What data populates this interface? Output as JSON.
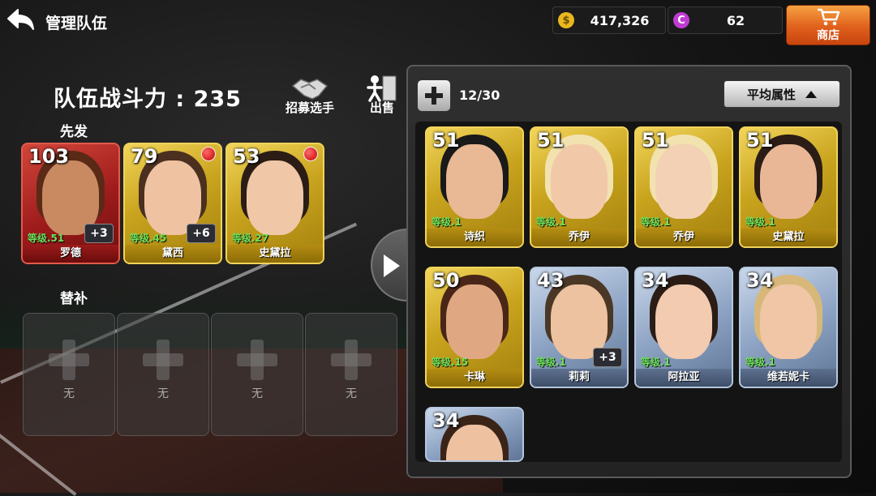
{
  "header": {
    "title": "管理队伍",
    "gold": "417,326",
    "gems": "62",
    "shop_label": "商店"
  },
  "team": {
    "power_label": "队伍战斗力 : 235",
    "recruit_label": "招募选手",
    "sell_label": "出售",
    "starters_label": "先发",
    "subs_label": "替补",
    "starters": [
      {
        "rating": "103",
        "level": "等级.51",
        "name": "罗德",
        "plus": "+3",
        "tier": "red",
        "alert": false
      },
      {
        "rating": "79",
        "level": "等级.45",
        "name": "黛西",
        "plus": "+6",
        "tier": "gold",
        "alert": true
      },
      {
        "rating": "53",
        "level": "等级.27",
        "name": "史黛拉",
        "plus": "",
        "tier": "gold",
        "alert": true
      }
    ],
    "subs": [
      "无",
      "无",
      "无",
      "无"
    ]
  },
  "roster": {
    "count": "12/30",
    "sort_label": "平均属性",
    "players": [
      {
        "rating": "51",
        "level": "等级.1",
        "name": "诗织",
        "plus": "",
        "tier": "gold"
      },
      {
        "rating": "51",
        "level": "等级.1",
        "name": "乔伊",
        "plus": "",
        "tier": "gold"
      },
      {
        "rating": "51",
        "level": "等级.1",
        "name": "乔伊",
        "plus": "",
        "tier": "gold"
      },
      {
        "rating": "51",
        "level": "等级.1",
        "name": "史黛拉",
        "plus": "",
        "tier": "gold"
      },
      {
        "rating": "50",
        "level": "等级.15",
        "name": "卡琳",
        "plus": "",
        "tier": "gold"
      },
      {
        "rating": "43",
        "level": "等级.1",
        "name": "莉莉",
        "plus": "+3",
        "tier": "blue"
      },
      {
        "rating": "34",
        "level": "等级.1",
        "name": "阿拉亚",
        "plus": "",
        "tier": "blue"
      },
      {
        "rating": "34",
        "level": "等级.1",
        "name": "维若妮卡",
        "plus": "",
        "tier": "blue"
      },
      {
        "rating": "34",
        "level": "",
        "name": "",
        "plus": "",
        "tier": "blue"
      }
    ]
  },
  "colors": {
    "level_text": "#6ee25b",
    "shop_button": "#e0601c",
    "gem": "#c03bd3",
    "coin": "#e8b81e"
  },
  "icons": {
    "back": "back-arrow-icon",
    "coin": "coin-icon",
    "gem": "gem-icon",
    "cart": "cart-icon",
    "recruit": "handshake-icon",
    "sell": "exit-person-icon"
  }
}
